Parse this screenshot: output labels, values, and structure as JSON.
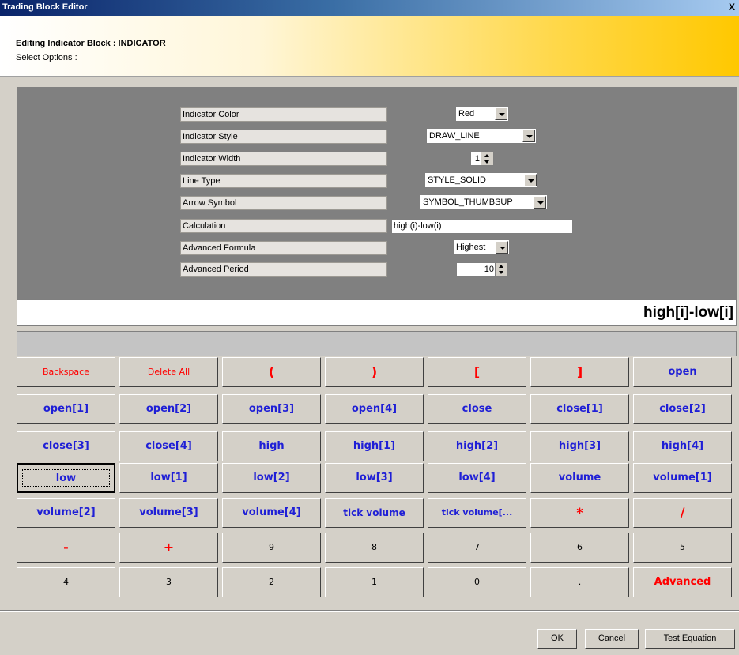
{
  "window": {
    "title": "Trading Block Editor",
    "close_label": "X"
  },
  "header": {
    "title": "Editing Indicator Block : INDICATOR",
    "subtitle": "Select Options :"
  },
  "options": {
    "indicator_color": {
      "label": "Indicator Color",
      "value": "Red"
    },
    "indicator_style": {
      "label": "Indicator Style",
      "value": "DRAW_LINE"
    },
    "indicator_width": {
      "label": "Indicator Width",
      "value": "1"
    },
    "line_type": {
      "label": "Line Type",
      "value": "STYLE_SOLID"
    },
    "arrow_symbol": {
      "label": "Arrow Symbol",
      "value": "SYMBOL_THUMBSUP"
    },
    "calculation": {
      "label": "Calculation",
      "value": "high(i)-low(i)"
    },
    "advanced_formula": {
      "label": "Advanced Formula",
      "value": "Highest"
    },
    "advanced_period": {
      "label": "Advanced Period",
      "value": "10"
    }
  },
  "display": {
    "expression": "high[i]-low[i]"
  },
  "keypad": {
    "backspace": "Backspace",
    "delete_all": "Delete All",
    "open_paren": "(",
    "close_paren": ")",
    "open_bracket": "[",
    "close_bracket": "]",
    "open": "open",
    "open1": "open[1]",
    "open2": "open[2]",
    "open3": "open[3]",
    "open4": "open[4]",
    "close": "close",
    "close1": "close[1]",
    "close2": "close[2]",
    "close3": "close[3]",
    "close4": "close[4]",
    "high": "high",
    "high1": "high[1]",
    "high2": "high[2]",
    "high3": "high[3]",
    "high4": "high[4]",
    "low": "low",
    "low1": "low[1]",
    "low2": "low[2]",
    "low3": "low[3]",
    "low4": "low[4]",
    "volume": "volume",
    "volume1": "volume[1]",
    "volume2": "volume[2]",
    "volume3": "volume[3]",
    "volume4": "volume[4]",
    "tick_volume": "tick volume",
    "tick_volume_trunc": "tick volume[...",
    "multiply": "*",
    "divide": "/",
    "minus": "-",
    "plus": "+",
    "n9": "9",
    "n8": "8",
    "n7": "7",
    "n6": "6",
    "n5": "5",
    "n4": "4",
    "n3": "3",
    "n2": "2",
    "n1": "1",
    "n0": "0",
    "dot": ".",
    "advanced": "Advanced"
  },
  "footer": {
    "ok": "OK",
    "cancel": "Cancel",
    "test": "Test Equation"
  }
}
